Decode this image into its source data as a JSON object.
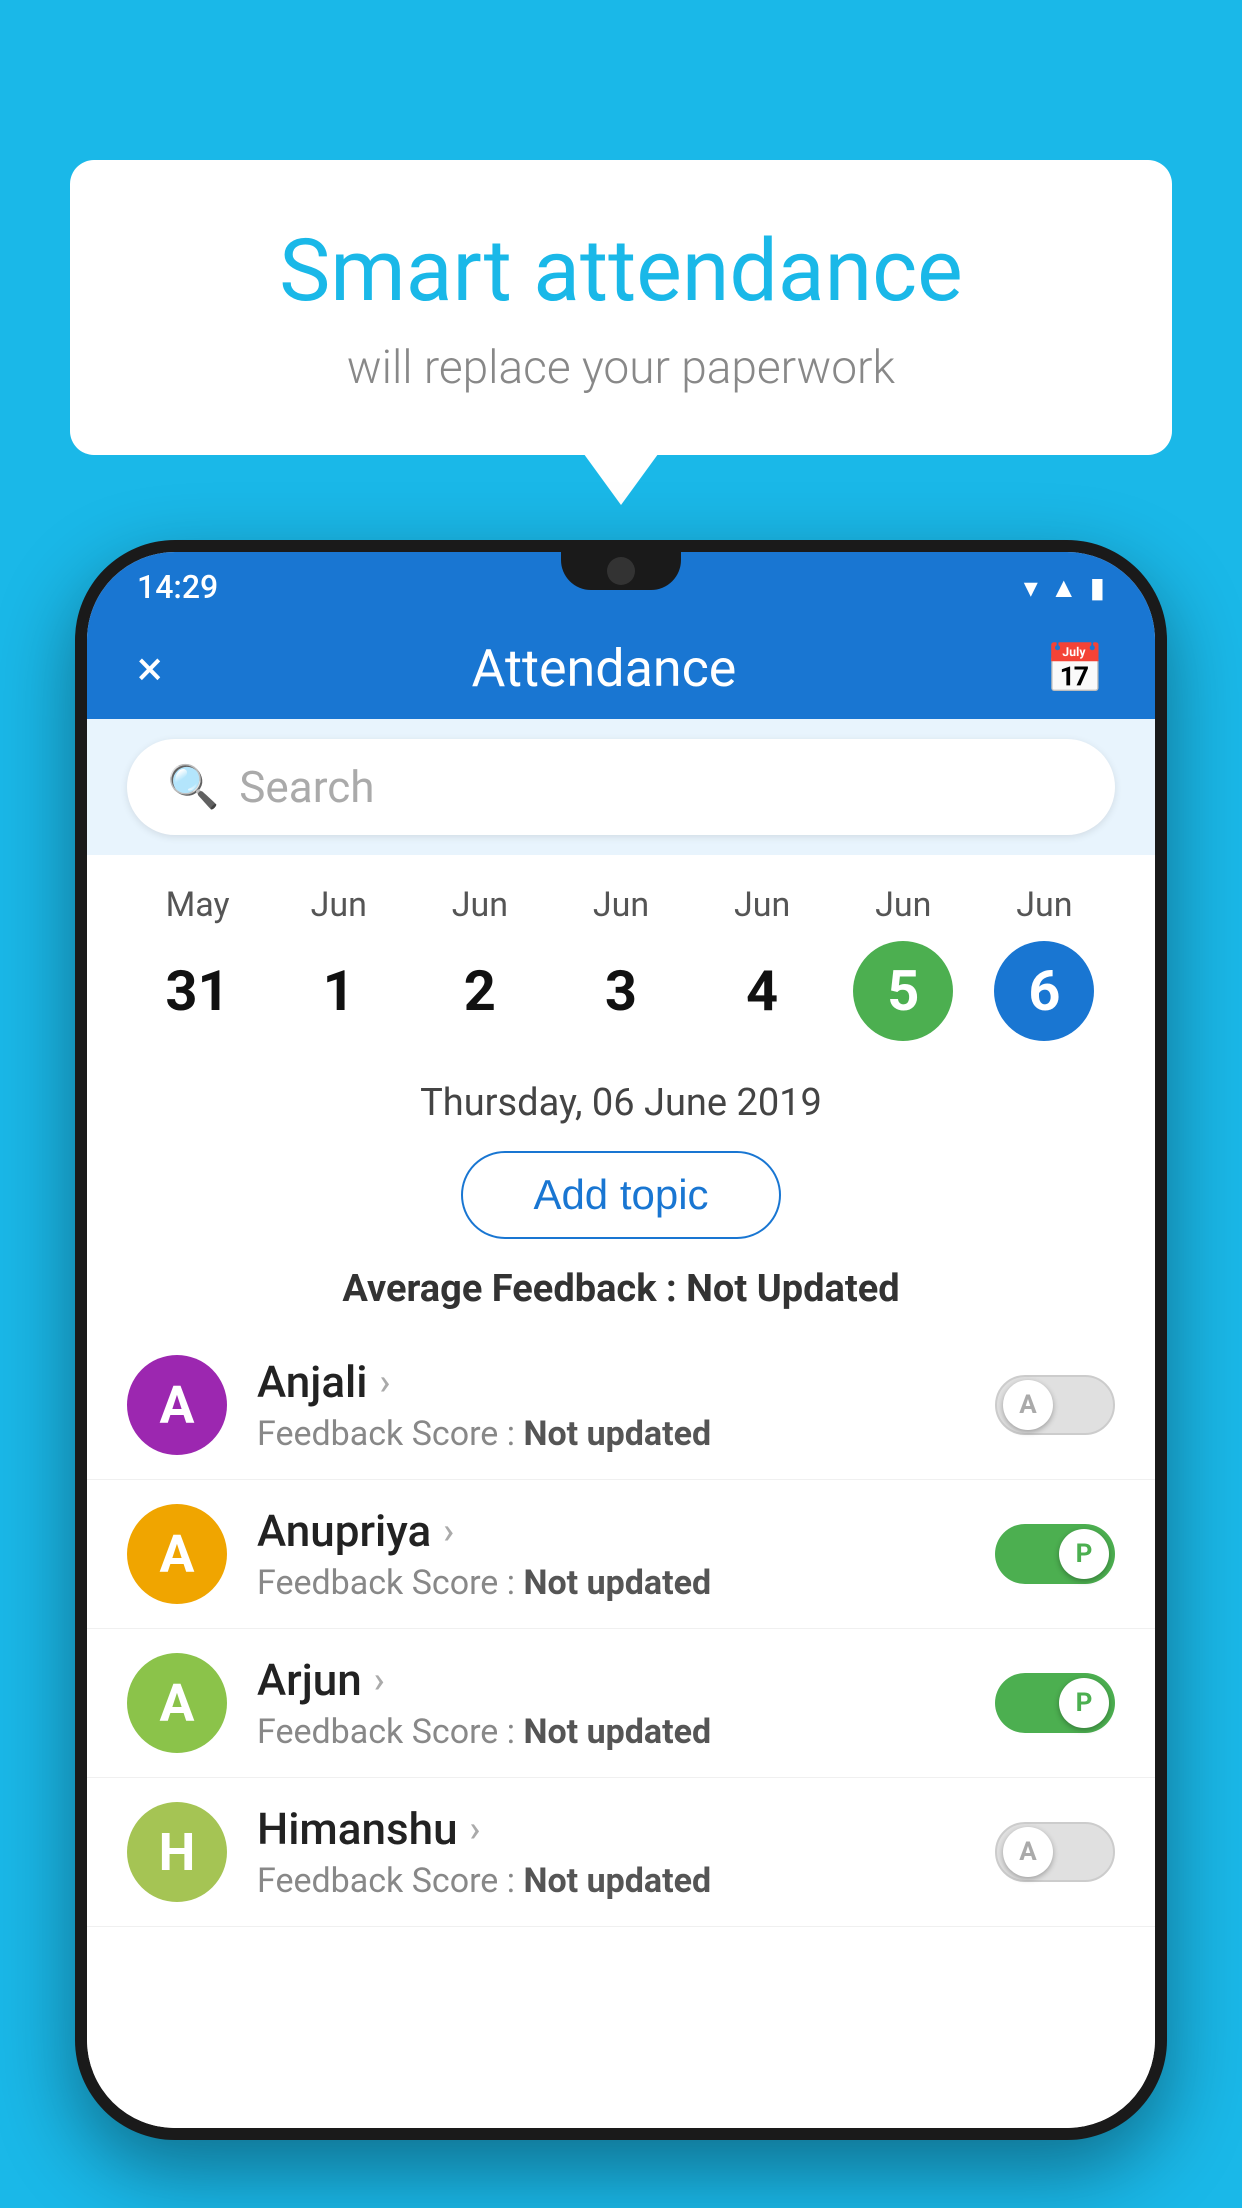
{
  "background": "#1ab8e8",
  "speech_bubble": {
    "title": "Smart attendance",
    "subtitle": "will replace your paperwork"
  },
  "status_bar": {
    "time": "14:29",
    "icons": [
      "wifi",
      "signal",
      "battery"
    ]
  },
  "app_bar": {
    "title": "Attendance",
    "close_label": "×",
    "calendar_icon": "📅"
  },
  "search": {
    "placeholder": "Search"
  },
  "calendar": {
    "days": [
      {
        "month": "May",
        "date": "31",
        "state": "normal"
      },
      {
        "month": "Jun",
        "date": "1",
        "state": "normal"
      },
      {
        "month": "Jun",
        "date": "2",
        "state": "normal"
      },
      {
        "month": "Jun",
        "date": "3",
        "state": "normal"
      },
      {
        "month": "Jun",
        "date": "4",
        "state": "normal"
      },
      {
        "month": "Jun",
        "date": "5",
        "state": "today"
      },
      {
        "month": "Jun",
        "date": "6",
        "state": "selected"
      }
    ]
  },
  "selected_date": "Thursday, 06 June 2019",
  "add_topic_label": "Add topic",
  "feedback_summary": {
    "prefix": "Average Feedback : ",
    "value": "Not Updated"
  },
  "students": [
    {
      "name": "Anjali",
      "avatar_letter": "A",
      "avatar_color": "#9c27b0",
      "feedback": "Feedback Score : ",
      "feedback_value": "Not updated",
      "toggle": "off",
      "toggle_label": "A"
    },
    {
      "name": "Anupriya",
      "avatar_letter": "A",
      "avatar_color": "#f0a500",
      "feedback": "Feedback Score : ",
      "feedback_value": "Not updated",
      "toggle": "on",
      "toggle_label": "P"
    },
    {
      "name": "Arjun",
      "avatar_letter": "A",
      "avatar_color": "#8bc34a",
      "feedback": "Feedback Score : ",
      "feedback_value": "Not updated",
      "toggle": "on",
      "toggle_label": "P"
    },
    {
      "name": "Himanshu",
      "avatar_letter": "H",
      "avatar_color": "#a5c454",
      "feedback": "Feedback Score : ",
      "feedback_value": "Not updated",
      "toggle": "off",
      "toggle_label": "A"
    }
  ]
}
